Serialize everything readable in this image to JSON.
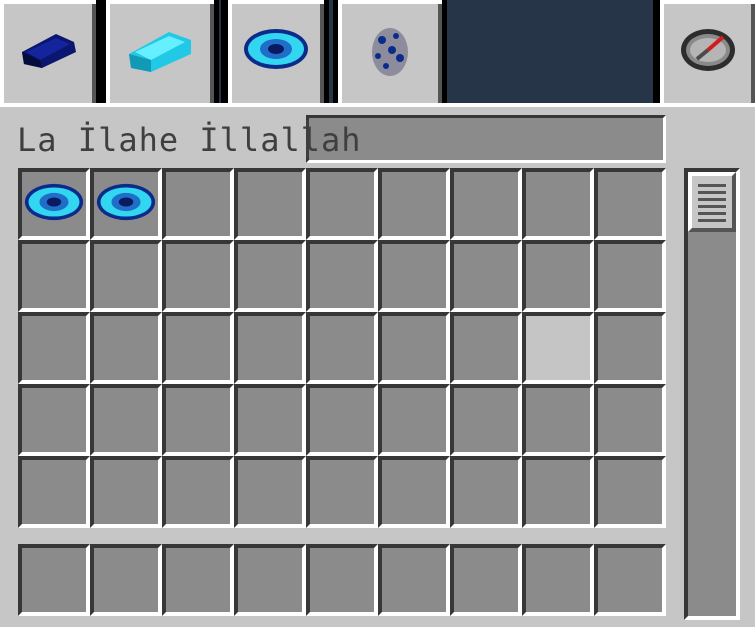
{
  "tabs": [
    {
      "name": "tab-blue-ingot",
      "icon": "dark-blue-ingot-icon",
      "selected": false
    },
    {
      "name": "tab-cyan-ingot",
      "icon": "cyan-ingot-icon",
      "selected": false
    },
    {
      "name": "tab-eye",
      "icon": "blue-eye-disc-icon",
      "selected": true
    },
    {
      "name": "tab-spawn-egg",
      "icon": "spotted-spawn-egg-icon",
      "selected": false
    },
    {
      "name": "tab-compass",
      "icon": "compass-icon",
      "selected": false
    }
  ],
  "search": {
    "label": "La İlahe İllallah",
    "value": ""
  },
  "inventory": {
    "rows": 5,
    "cols": 9,
    "items": [
      {
        "slot": 0,
        "icon": "blue-eye-disc-icon"
      },
      {
        "slot": 1,
        "icon": "blue-eye-disc-icon"
      }
    ],
    "highlighted_slot": 25
  },
  "hotbar": {
    "cols": 9
  },
  "colors": {
    "panel": "#c6c6c6",
    "slot": "#8b8b8b",
    "eye_cyan": "#33d6f0",
    "eye_dark": "#0b2b8a",
    "background": "#263547"
  }
}
